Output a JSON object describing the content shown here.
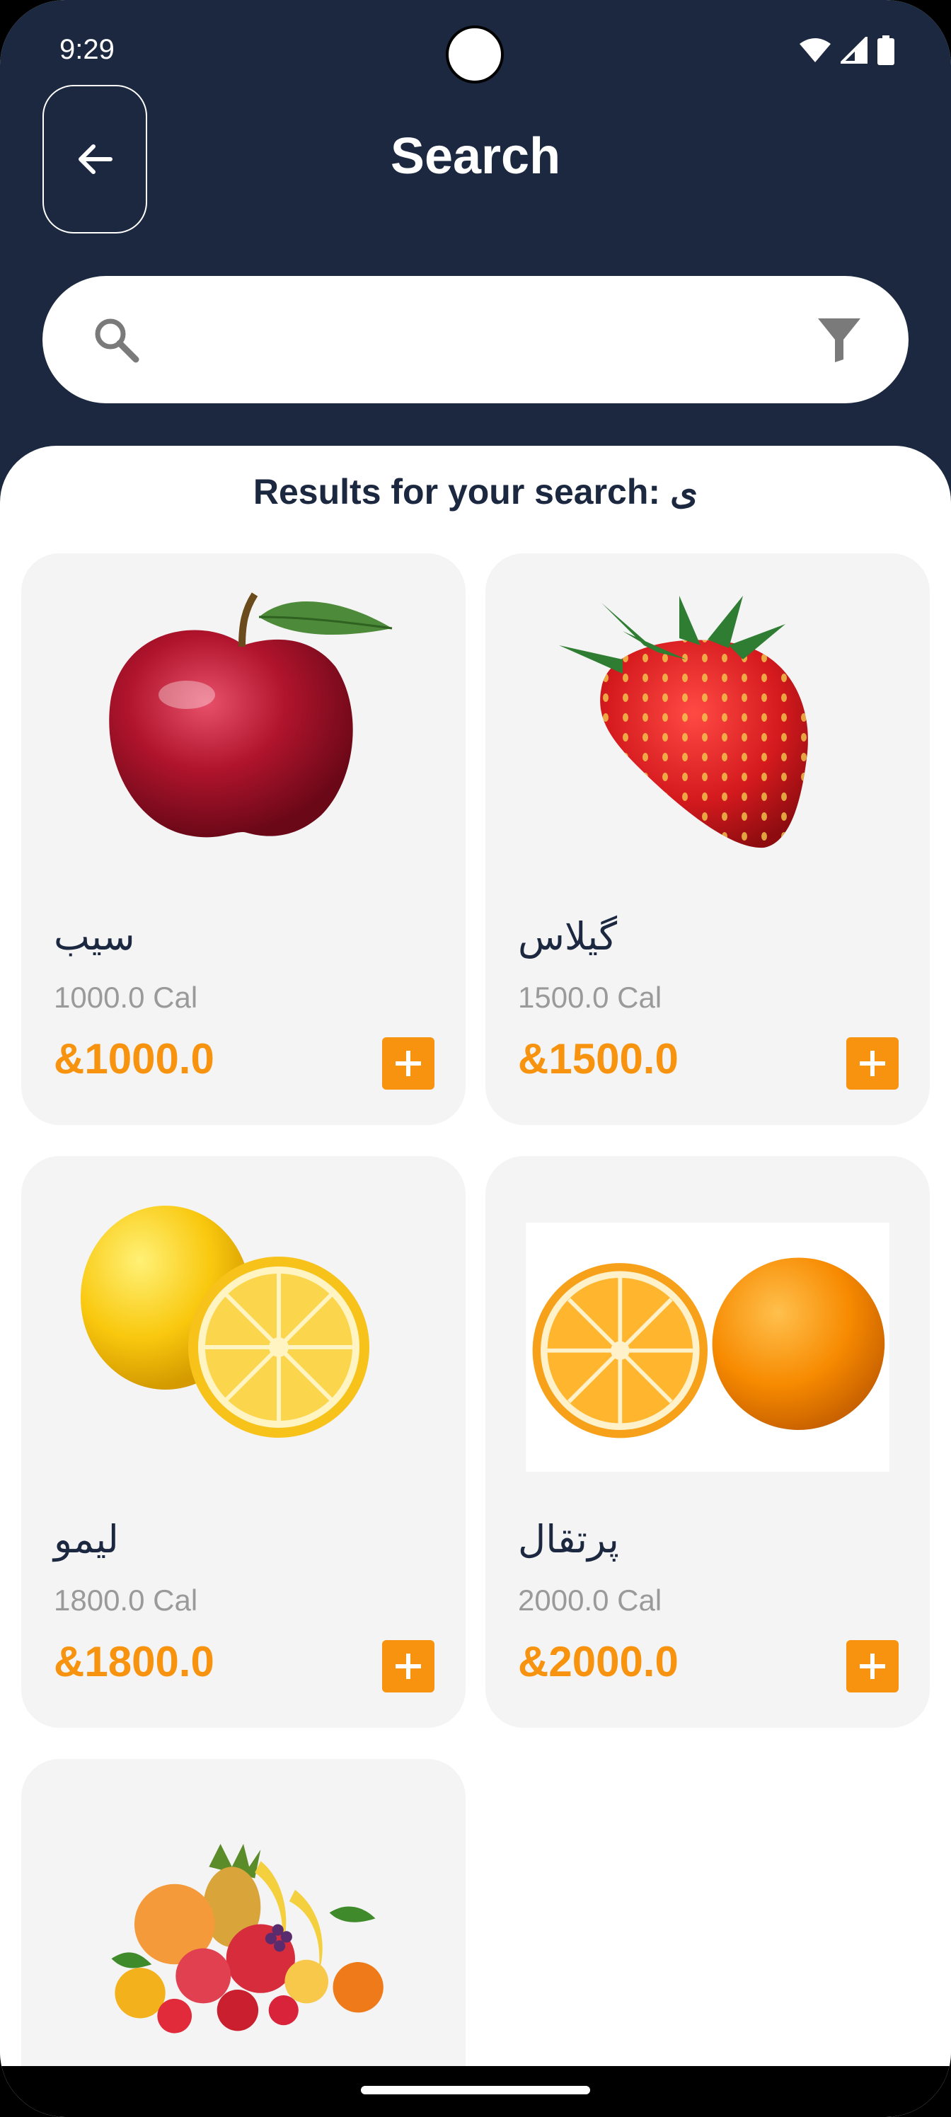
{
  "status_bar": {
    "time": "9:29"
  },
  "header": {
    "title": "Search"
  },
  "search": {
    "value": "",
    "placeholder": ""
  },
  "results": {
    "label": "Results for your search: ی"
  },
  "products": [
    {
      "name": "سیب",
      "calories": "1000.0 Cal",
      "price": "&1000.0",
      "image": "red-apple"
    },
    {
      "name": "گیلاس",
      "calories": "1500.0 Cal",
      "price": "&1500.0",
      "image": "strawberry"
    },
    {
      "name": "لیمو",
      "calories": "1800.0 Cal",
      "price": "&1800.0",
      "image": "lemon"
    },
    {
      "name": "پرتقال",
      "calories": "2000.0 Cal",
      "price": "&2000.0",
      "image": "orange"
    },
    {
      "name": "",
      "calories": "",
      "price": "",
      "image": "mixed-fruits"
    }
  ],
  "colors": {
    "header_bg": "#1b2840",
    "accent": "#f7930e",
    "card_bg": "#f4f4f4"
  }
}
